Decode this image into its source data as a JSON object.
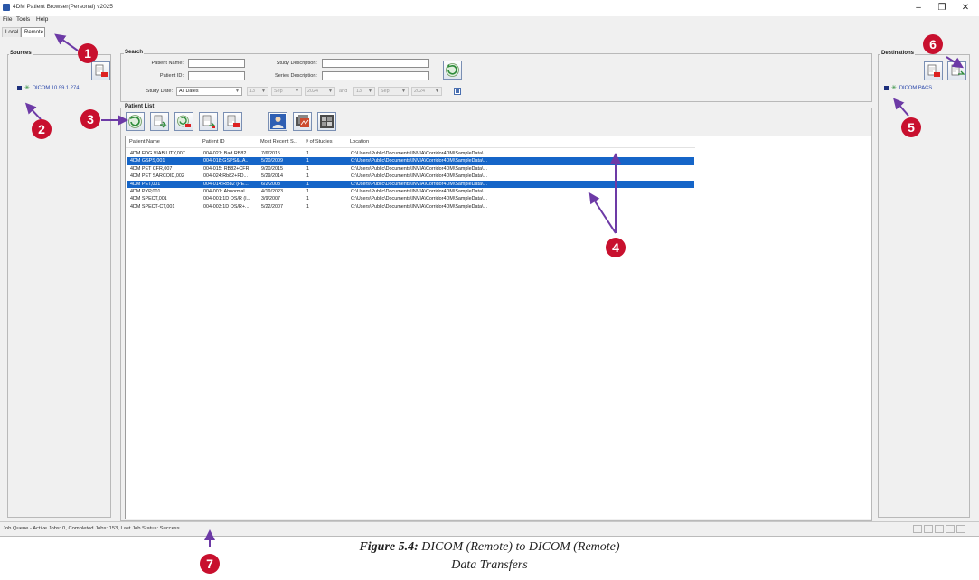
{
  "window": {
    "title": "4DM Patient Browser(Personal) v2025",
    "controls": {
      "minimize": "–",
      "maximize": "❐",
      "close": "✕"
    }
  },
  "menu": [
    "File",
    "Tools",
    "Help"
  ],
  "tabs": [
    {
      "label": "Local",
      "active": false
    },
    {
      "label": "Remote",
      "active": true
    }
  ],
  "sources": {
    "title": "Sources",
    "items": [
      "DICOM 10.99.1.274"
    ]
  },
  "search": {
    "title": "Search",
    "patient_name_label": "Patient Name:",
    "patient_id_label": "Patient ID:",
    "study_date_label": "Study Date:",
    "study_description_label": "Study Description:",
    "series_description_label": "Series Description:",
    "date_mode": "All Dates",
    "from_day": "13",
    "from_month": "Sep",
    "from_year": "2024",
    "and_label": "and",
    "to_day": "13",
    "to_month": "Sep",
    "to_year": "2024"
  },
  "patient_list": {
    "title": "Patient List",
    "columns": [
      "Patient Name",
      "Patient ID",
      "Most Recent S...",
      "# of Studies",
      "Location"
    ],
    "rows": [
      {
        "name": "4DM FDG VIABILITY,007",
        "id": "004-027: Bad RB82",
        "date": "7/6/2015",
        "studies": "1",
        "location": "C:\\Users\\Public\\Documents\\INVIA\\Corridor4DM\\SampleData\\...",
        "selected": false
      },
      {
        "name": "4DM GSPS,001",
        "id": "004-018:GSPS&LA...",
        "date": "5/20/2009",
        "studies": "1",
        "location": "C:\\Users\\Public\\Documents\\INVIA\\Corridor4DM\\SampleData\\...",
        "selected": true
      },
      {
        "name": "4DM PET CFR,007",
        "id": "004-015: RB82+CFR",
        "date": "9/20/2015",
        "studies": "1",
        "location": "C:\\Users\\Public\\Documents\\INVIA\\Corridor4DM\\SampleData\\...",
        "selected": false
      },
      {
        "name": "4DM PET SARCOID,002",
        "id": "004-024:Rb82+FD...",
        "date": "5/29/2014",
        "studies": "1",
        "location": "C:\\Users\\Public\\Documents\\INVIA\\Corridor4DM\\SampleData\\...",
        "selected": false
      },
      {
        "name": "4DM PET,001",
        "id": "004-014:RB82 (PE...",
        "date": "6/2/2008",
        "studies": "1",
        "location": "C:\\Users\\Public\\Documents\\INVIA\\Corridor4DM\\SampleData\\...",
        "selected": true
      },
      {
        "name": "4DM PYP,001",
        "id": "004-001: Abnormal...",
        "date": "4/19/2023",
        "studies": "1",
        "location": "C:\\Users\\Public\\Documents\\INVIA\\Corridor4DM\\SampleData\\...",
        "selected": false
      },
      {
        "name": "4DM SPECT,001",
        "id": "004-001:1D OS/R (I...",
        "date": "3/9/2007",
        "studies": "1",
        "location": "C:\\Users\\Public\\Documents\\INVIA\\Corridor4DM\\SampleData\\...",
        "selected": false
      },
      {
        "name": "4DM SPECT-CT,001",
        "id": "004-003:1D OS/R+...",
        "date": "5/22/2007",
        "studies": "1",
        "location": "C:\\Users\\Public\\Documents\\INVIA\\Corridor4DM\\SampleData\\...",
        "selected": false
      }
    ]
  },
  "destinations": {
    "title": "Destinations",
    "items": [
      "DICOM PACS"
    ]
  },
  "status": {
    "text": "Job Queue - Active Jobs: 0, Completed Jobs: 153, Last Job Status: Success"
  },
  "callouts": [
    "1",
    "2",
    "3",
    "4",
    "5",
    "6",
    "7"
  ],
  "colors": {
    "callout": "#c8102e",
    "selection": "#1565c8",
    "tree_text": "#1f3ea6"
  },
  "caption": {
    "label": "Figure 5.4:",
    "line1": "DICOM (Remote) to DICOM (Remote)",
    "line2": "Data Transfers"
  }
}
